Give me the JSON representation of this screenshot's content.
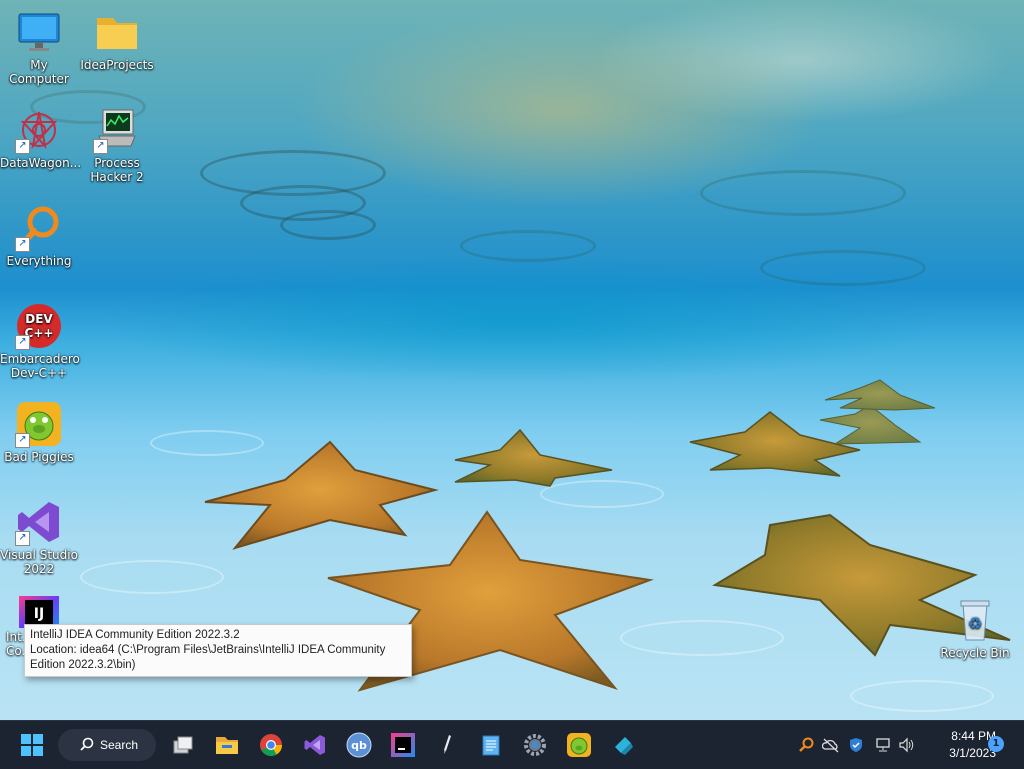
{
  "desktop": {
    "icons": [
      {
        "label": "My Computer",
        "icon": "monitor-icon"
      },
      {
        "label": "IdeaProjects",
        "icon": "folder-icon"
      },
      {
        "label": "DataWagon...",
        "icon": "datawagon-icon"
      },
      {
        "label": "Process Hacker 2",
        "icon": "process-hacker-icon"
      },
      {
        "label": "Everything",
        "icon": "everything-search-icon"
      },
      {
        "label": "Embarcadero Dev-C++",
        "icon": "devcpp-icon",
        "badge": "DEV C++"
      },
      {
        "label": "Bad Piggies",
        "icon": "bad-piggies-icon"
      },
      {
        "label": "Visual Studio 2022",
        "icon": "visual-studio-icon"
      },
      {
        "label": "Int...",
        "sub": "Co...",
        "icon": "intellij-icon",
        "badge": "IJ"
      },
      {
        "label": "Recycle Bin",
        "icon": "recycle-bin-icon"
      }
    ]
  },
  "tooltip": {
    "line1": "IntelliJ IDEA Community Edition 2022.3.2",
    "line2": "Location: idea64 (C:\\Program Files\\JetBrains\\IntelliJ IDEA Community Edition 2022.3.2\\bin)"
  },
  "taskbar": {
    "search_label": "Search",
    "apps": [
      "start-icon",
      "task-view-icon",
      "file-explorer-icon",
      "chrome-icon",
      "visual-studio-icon",
      "qbittorrent-icon",
      "intellij-icon",
      "pen-icon",
      "notepad-icon",
      "settings-icon",
      "bad-piggies-icon",
      "app-icon"
    ],
    "tray": [
      "everything-search-icon",
      "onedrive-icon",
      "security-icon",
      "network-icon",
      "volume-icon"
    ],
    "time": "8:44 PM",
    "date": "3/1/2023",
    "notification_count": "1"
  },
  "colors": {
    "taskbar_bg": "#1c2331",
    "accent": "#4aa3ff"
  }
}
